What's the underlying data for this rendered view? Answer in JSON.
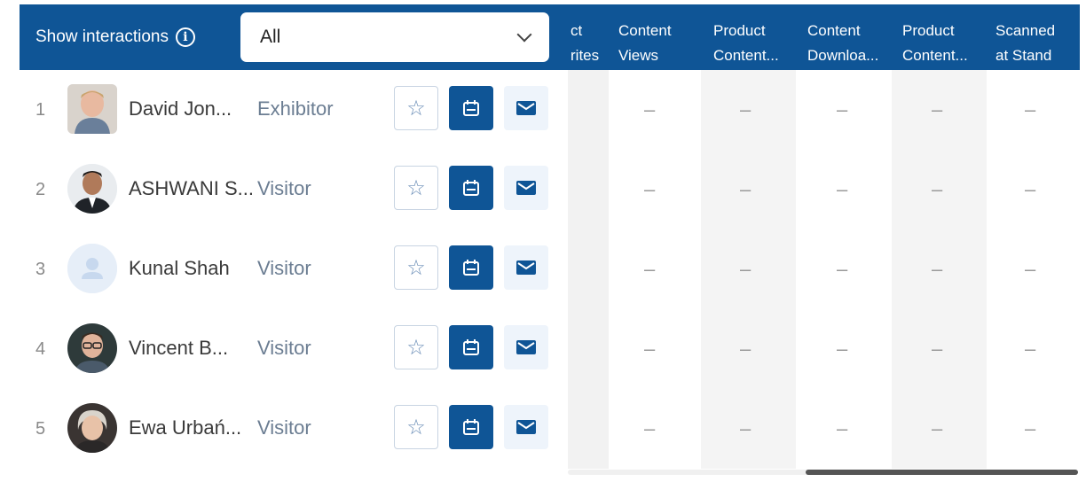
{
  "filter": {
    "label": "Show interactions",
    "selected": "All"
  },
  "columns": [
    {
      "line1": "ct",
      "line2": "rites"
    },
    {
      "line1": "Content",
      "line2": "Views"
    },
    {
      "line1": "Product",
      "line2": "Content..."
    },
    {
      "line1": "Content",
      "line2": "Downloa..."
    },
    {
      "line1": "Product",
      "line2": "Content..."
    },
    {
      "line1": "Scanned",
      "line2": "at Stand"
    }
  ],
  "rows": [
    {
      "rank": "1",
      "name": "David Jon...",
      "role": "Exhibitor",
      "values": [
        "–",
        "–",
        "–",
        "–",
        "–"
      ]
    },
    {
      "rank": "2",
      "name": "ASHWANI S...",
      "role": "Visitor",
      "values": [
        "–",
        "–",
        "–",
        "–",
        "–"
      ]
    },
    {
      "rank": "3",
      "name": "Kunal Shah",
      "role": "Visitor",
      "values": [
        "–",
        "–",
        "–",
        "–",
        "–"
      ]
    },
    {
      "rank": "4",
      "name": "Vincent B...",
      "role": "Visitor",
      "values": [
        "–",
        "–",
        "–",
        "–",
        "–"
      ]
    },
    {
      "rank": "5",
      "name": "Ewa Urbań...",
      "role": "Visitor",
      "values": [
        "–",
        "–",
        "–",
        "–",
        "–"
      ]
    }
  ],
  "icons": {
    "info": "info-icon",
    "dropdown": "chevron-down-icon",
    "favorite": "star-icon",
    "meeting": "calendar-icon",
    "message": "mail-icon",
    "avatar_placeholder": "user-icon"
  },
  "colors": {
    "header": "#0f5596",
    "accent": "#0f5596",
    "role_text": "#6b7d92"
  }
}
